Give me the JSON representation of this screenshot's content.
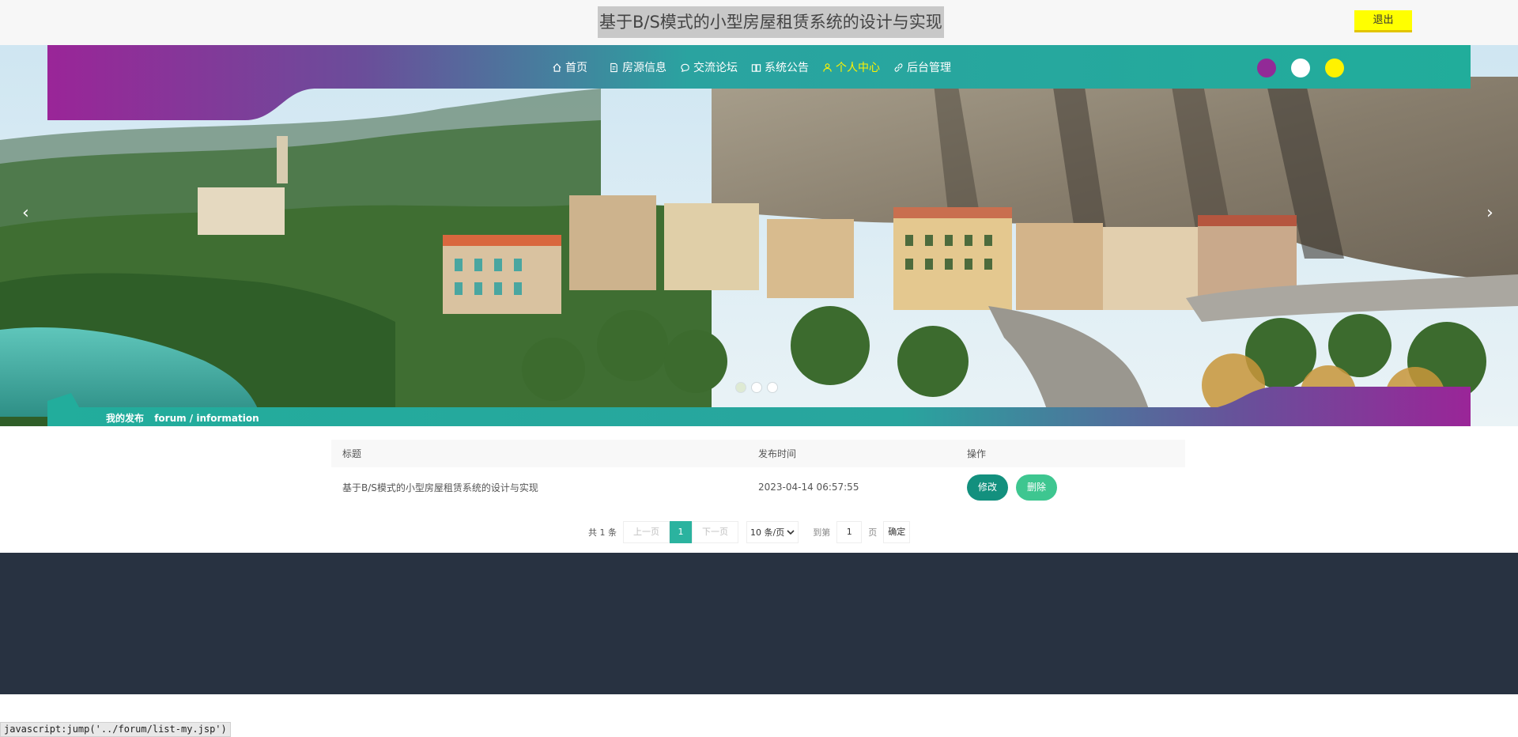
{
  "header": {
    "site_title": "基于B/S模式的小型房屋租赁系统的设计与实现",
    "logout_label": "退出"
  },
  "nav": {
    "items": [
      {
        "label": "首页",
        "icon": "home-icon",
        "active": false
      },
      {
        "label": "房源信息",
        "icon": "document-icon",
        "active": false
      },
      {
        "label": "交流论坛",
        "icon": "chat-icon",
        "active": false
      },
      {
        "label": "系统公告",
        "icon": "book-icon",
        "active": false
      },
      {
        "label": "个人中心",
        "icon": "user-icon",
        "active": true
      },
      {
        "label": "后台管理",
        "icon": "link-icon",
        "active": false
      }
    ],
    "theme_colors": [
      "#922a97",
      "#ffffff",
      "#fff200"
    ]
  },
  "carousel": {
    "prev": "‹",
    "next": "›",
    "slides": 3,
    "active_slide": 1
  },
  "breadcrumb": {
    "title": "我的发布",
    "path": "forum / information"
  },
  "table": {
    "headers": [
      "标题",
      "发布时间",
      "操作"
    ],
    "rows": [
      {
        "title": "基于B/S模式的小型房屋租赁系统的设计与实现",
        "time": "2023-04-14 06:57:55",
        "edit": "修改",
        "delete": "删除"
      }
    ]
  },
  "pagination": {
    "total": "共 1 条",
    "prev": "上一页",
    "current": "1",
    "next": "下一页",
    "page_size": "10 条/页",
    "goto_label": "到第",
    "goto_value": "1",
    "page_unit": "页",
    "confirm": "确定"
  },
  "statusbar": {
    "text": "javascript:jump('../forum/list-my.jsp')"
  },
  "colors": {
    "teal": "#25b3a0",
    "purple": "#922a97",
    "footer": "#283241",
    "accent_yellow": "#fff200"
  }
}
